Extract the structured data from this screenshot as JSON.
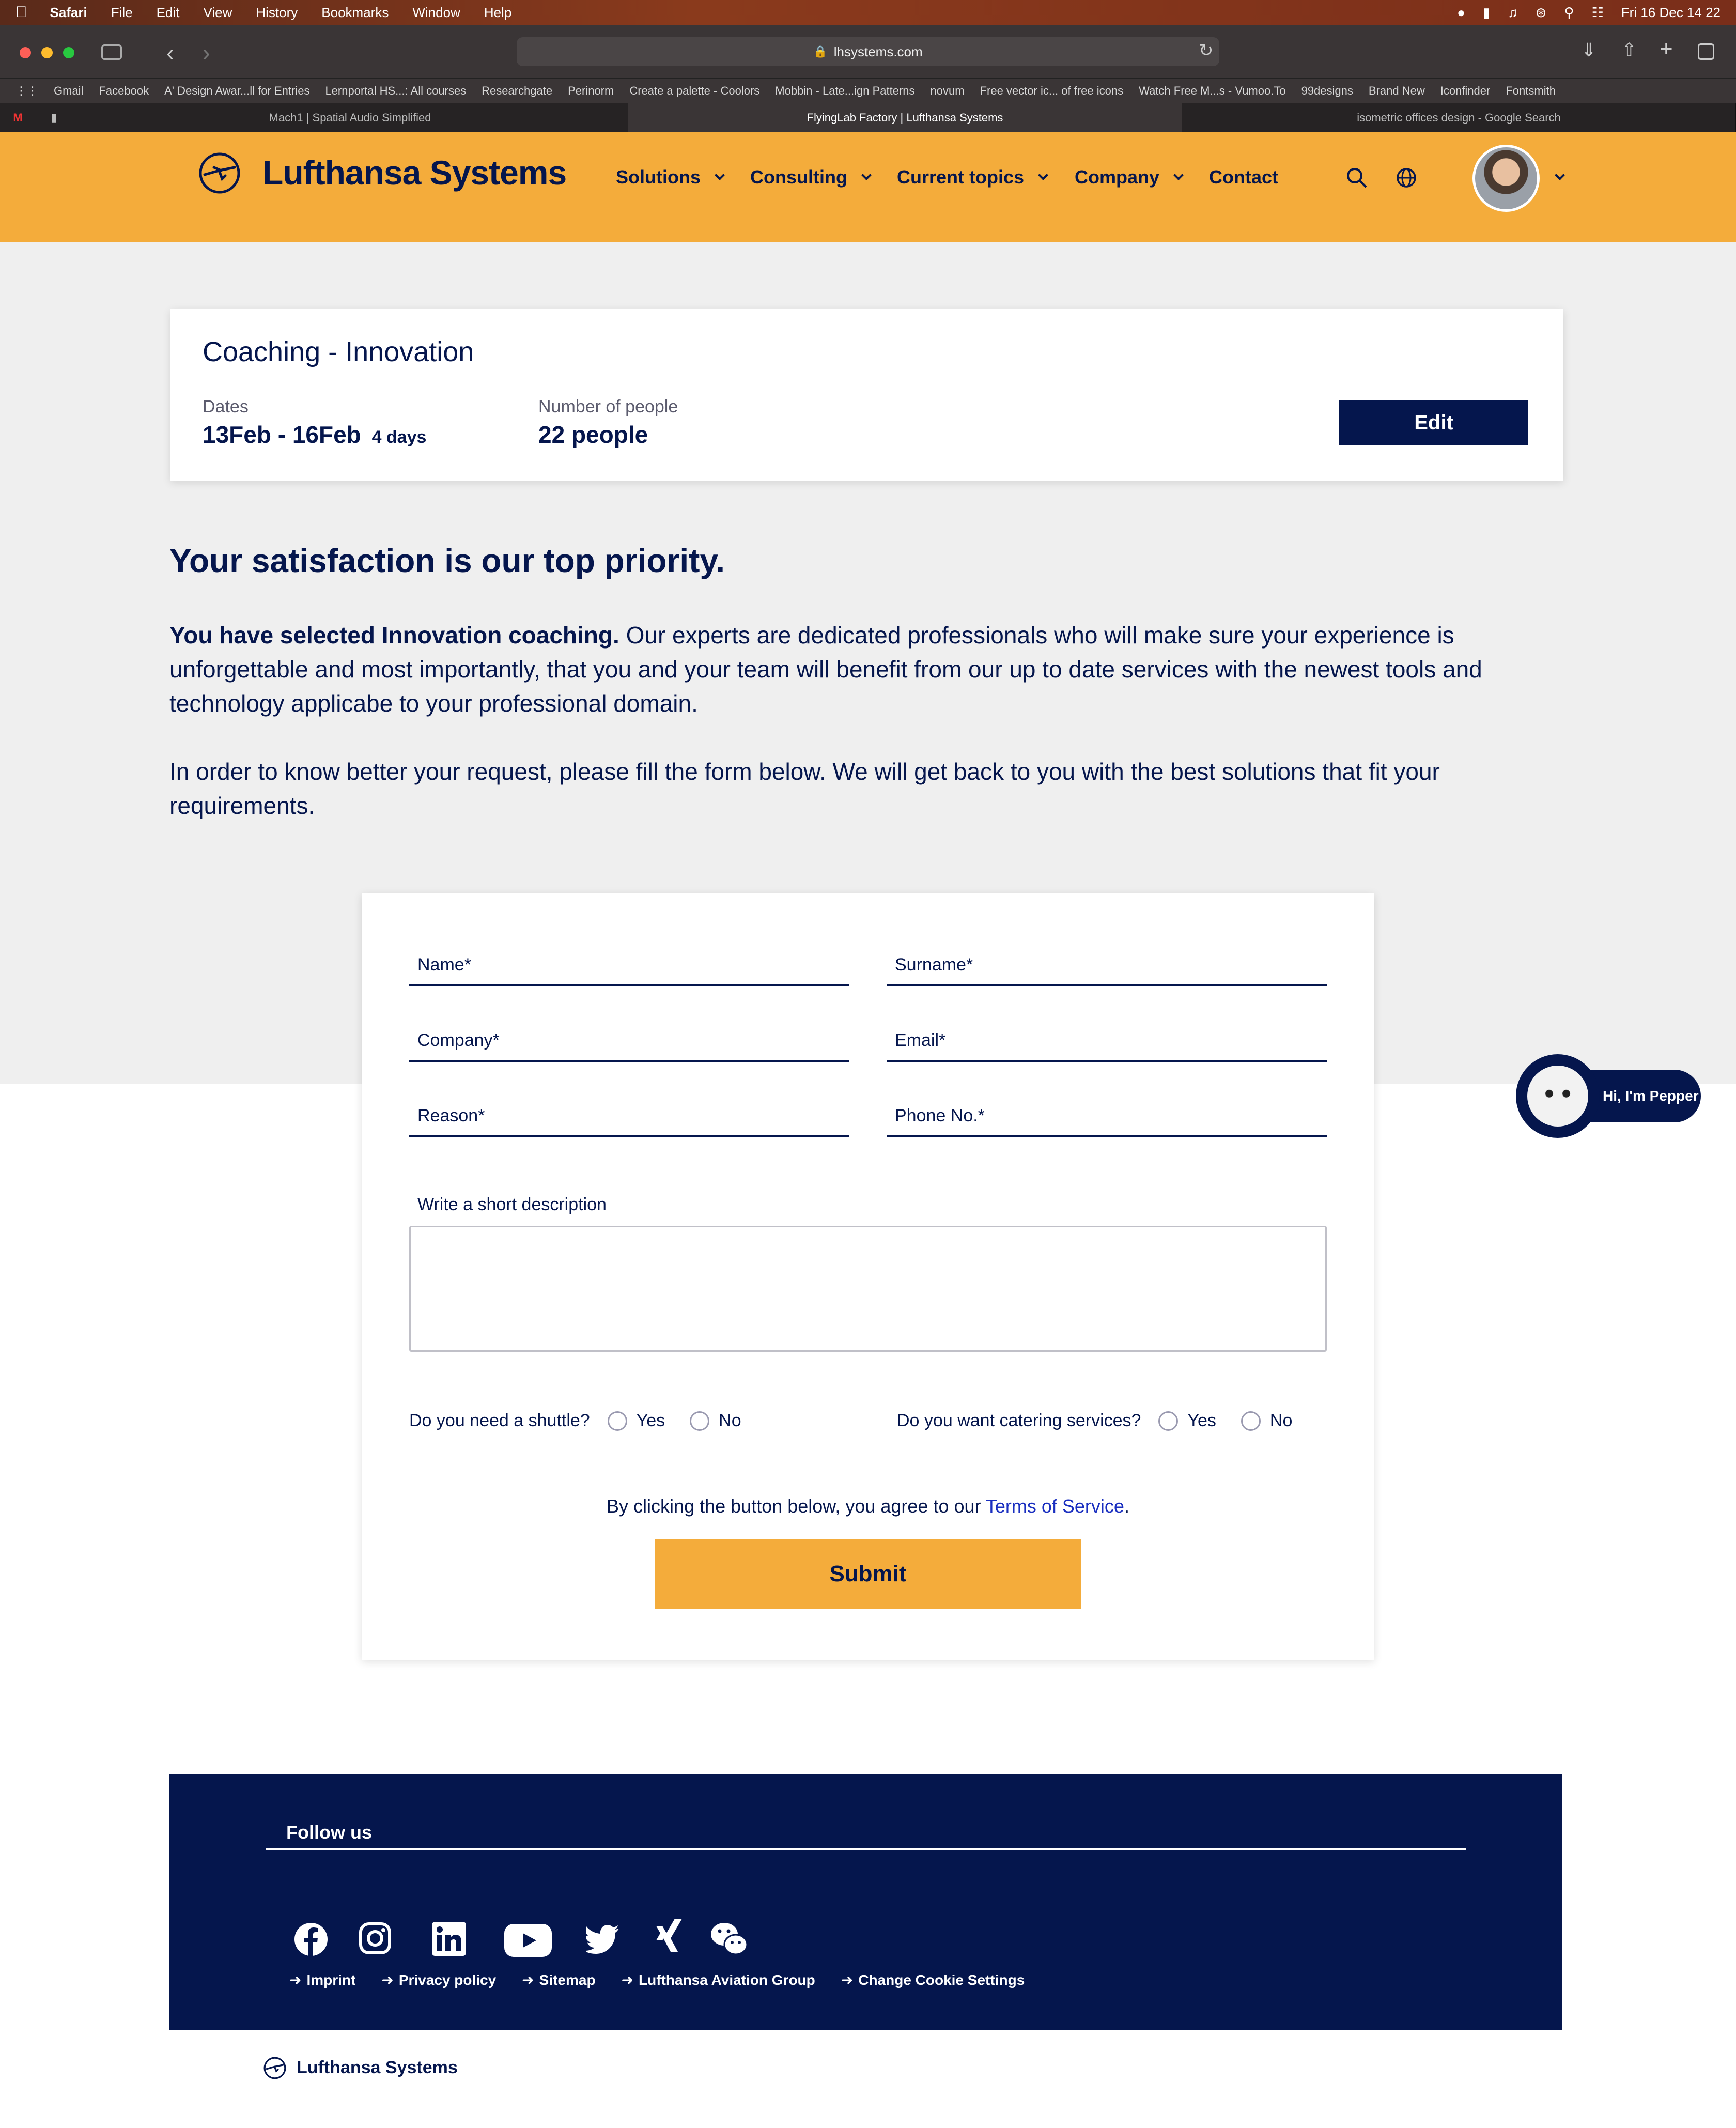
{
  "menubar": {
    "app": "Safari",
    "items": [
      "File",
      "Edit",
      "View",
      "History",
      "Bookmarks",
      "Window",
      "Help"
    ],
    "clock": "Fri 16 Dec  14 22"
  },
  "browser": {
    "url": "lhsystems.com",
    "bookmarks": [
      "Gmail",
      "Facebook",
      "A' Design Awar...ll for Entries",
      "Lernportal HS...: All courses",
      "Researchgate",
      "Perinorm",
      "Create a palette - Coolors",
      "Mobbin - Late...ign Patterns",
      "novum",
      "Free vector ic... of free icons",
      "Watch Free M...s - Vumoo.To",
      "99designs",
      "Brand New",
      "Iconfinder",
      "Fontsmith"
    ],
    "tabs": [
      {
        "label": "Mach1 | Spatial Audio Simplified",
        "active": false
      },
      {
        "label": "FlyingLab Factory | Lufthansa Systems",
        "active": true
      },
      {
        "label": "isometric offices design - Google Search",
        "active": false
      }
    ]
  },
  "header": {
    "brand": "Lufthansa Systems",
    "nav": [
      "Solutions",
      "Consulting",
      "Current topics",
      "Company",
      "Contact"
    ],
    "bg": "#f4ac3b"
  },
  "booking": {
    "title": "Coaching - Innovation",
    "dates_label": "Dates",
    "dates_value": "13Feb - 16Feb",
    "dates_duration": "4 days",
    "people_label": "Number of people",
    "people_value": "22 people",
    "edit_label": "Edit"
  },
  "intro": {
    "heading": "Your satisfaction is our top priority.",
    "p1_bold": "You have selected Innovation coaching.",
    "p1_rest": " Our experts are dedicated professionals who will make sure your experience is unforgettable and most importantly, that you and your team will benefit from our up to date services with the newest tools and technology applicabe to your professional domain.",
    "p2": "In order to know better your request, please fill the form below. We will get back to you with the best solutions that fit your requirements."
  },
  "form": {
    "name": "Name*",
    "surname": "Surname*",
    "company": "Company*",
    "email": "Email*",
    "reason": "Reason*",
    "phone": "Phone No.*",
    "description_label": "Write a short description",
    "shuttle_q": "Do you need a shuttle?",
    "catering_q": "Do you want catering services?",
    "yes": "Yes",
    "no": "No",
    "terms_prefix": "By clicking the button below, you agree to our ",
    "terms_link": "Terms of Service",
    "terms_suffix": ".",
    "submit": "Submit"
  },
  "chatbot": {
    "label": "Hi, I'm Pepper"
  },
  "footer": {
    "follow": "Follow us",
    "social_icons": [
      "facebook-icon",
      "instagram-icon",
      "linkedin-icon",
      "youtube-icon",
      "twitter-icon",
      "xing-icon",
      "wechat-icon"
    ],
    "links": [
      "Imprint",
      "Privacy policy",
      "Sitemap",
      "Lufthansa Aviation Group",
      "Change Cookie Settings"
    ],
    "brand": "Lufthansa Systems"
  }
}
